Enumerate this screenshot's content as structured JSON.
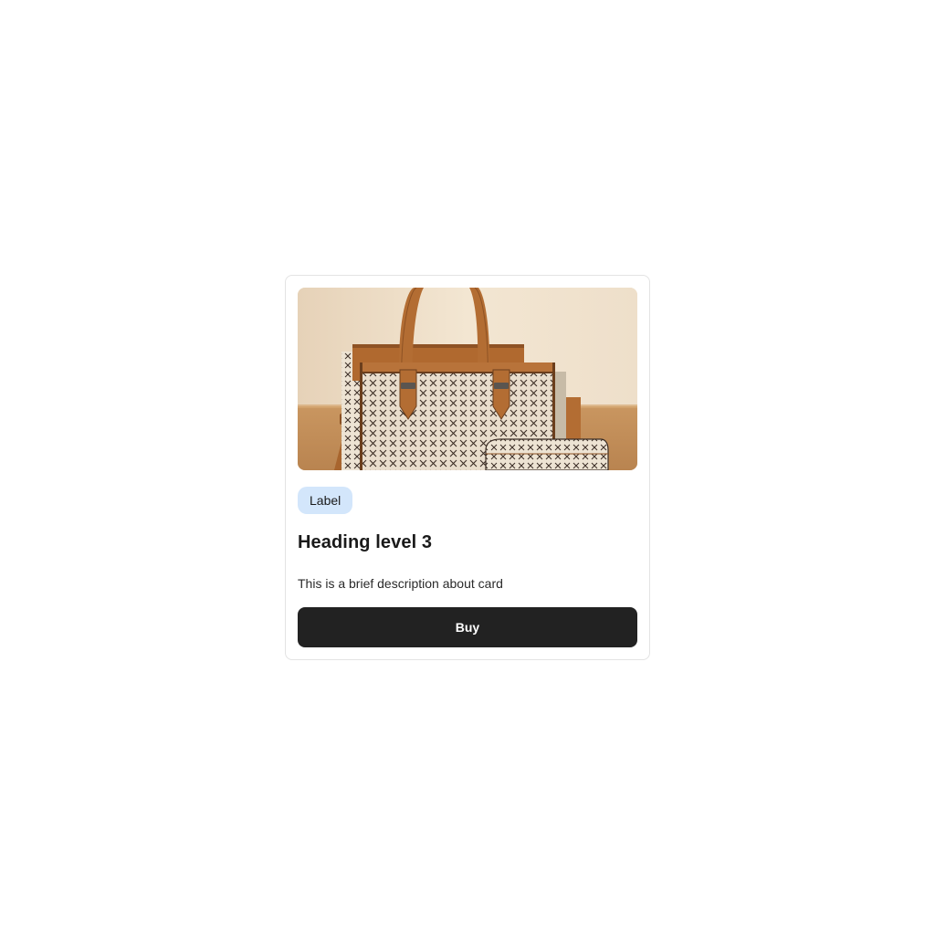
{
  "card": {
    "image_alt": "Handbag product photo",
    "label": "Label",
    "heading": "Heading level 3",
    "description": "This is a brief description about card",
    "button_label": "Buy"
  },
  "colors": {
    "chip_bg": "#d3e6fb",
    "button_bg": "#222222",
    "card_border": "#e3e3e3"
  }
}
